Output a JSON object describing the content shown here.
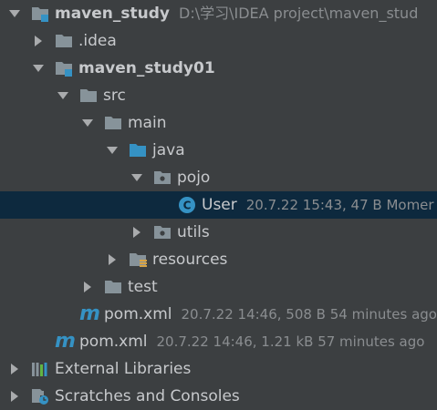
{
  "tree": {
    "root": {
      "name": "maven_study",
      "path": "D:\\学习\\IDEA project\\maven_stud"
    },
    "idea": {
      "name": ".idea"
    },
    "module": {
      "name": "maven_study01"
    },
    "src": {
      "name": "src"
    },
    "main": {
      "name": "main"
    },
    "java": {
      "name": "java"
    },
    "pojo": {
      "name": "pojo"
    },
    "user": {
      "name": "User",
      "meta": "20.7.22 15:43, 47 B Momer",
      "icon_letter": "C"
    },
    "utils": {
      "name": "utils"
    },
    "resources": {
      "name": "resources"
    },
    "test": {
      "name": "test"
    },
    "module_pom": {
      "name": "pom.xml",
      "meta": "20.7.22 14:46, 508 B 54 minutes ago",
      "icon_letter": "m"
    },
    "root_pom": {
      "name": "pom.xml",
      "meta": "20.7.22 14:46, 1.21 kB 57 minutes ago",
      "icon_letter": "m"
    },
    "external_libraries": {
      "name": "External Libraries"
    },
    "scratches": {
      "name": "Scratches and Consoles"
    }
  },
  "colors": {
    "background": "#3c3f41",
    "selection": "#0d293e",
    "text": "#c7c9cc",
    "meta_text": "#8a8d90",
    "folder": "#87939a",
    "source_folder": "#3592c4",
    "module_badge": "#3592c4",
    "class_icon": "#3592c4",
    "resources_badge": "#d9a343"
  }
}
